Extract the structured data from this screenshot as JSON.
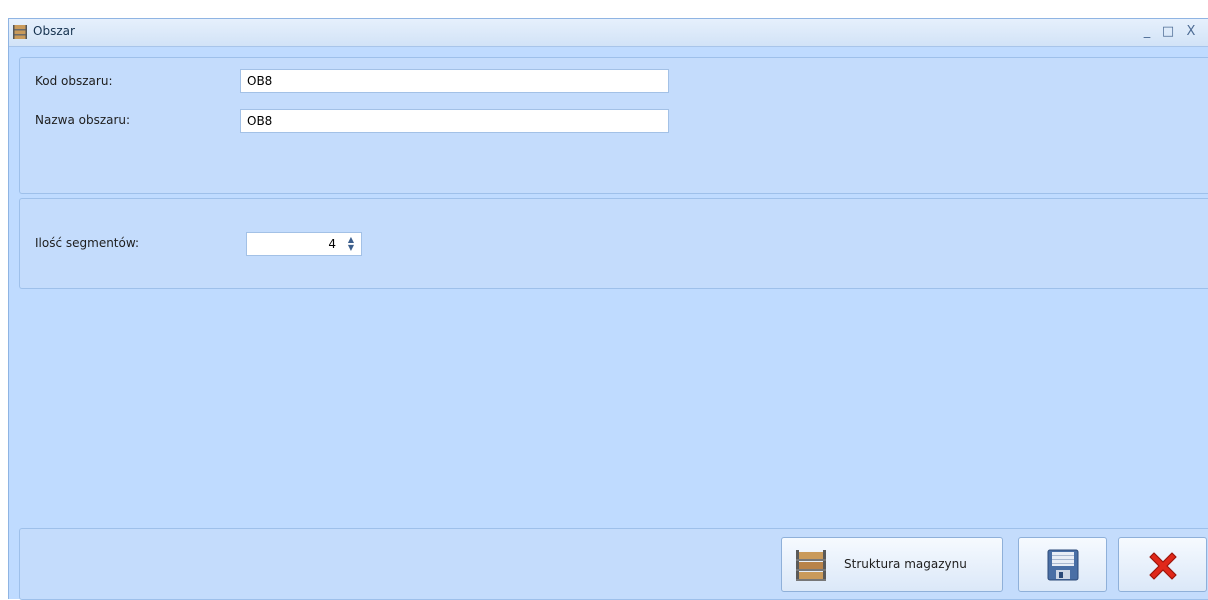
{
  "window": {
    "title": "Obszar",
    "icon": "shelf-icon",
    "controls": {
      "minimize": "_",
      "maximize": "□",
      "close": "X"
    }
  },
  "form": {
    "kod_label": "Kod obszaru:",
    "kod_value": "OB8",
    "nazwa_label": "Nazwa obszaru:",
    "nazwa_value": "OB8",
    "segmenty_label": "Ilość segmentów:",
    "segmenty_value": "4"
  },
  "buttons": {
    "struktura_label": "Struktura magazynu",
    "struktura_icon": "shelf-icon",
    "save_icon": "floppy-disk-icon",
    "cancel_icon": "red-x-icon"
  },
  "colors": {
    "background": "#bfdbff",
    "panel": "#c4dcfc",
    "border": "#9ec0ea",
    "cancel_red": "#e0281a"
  }
}
